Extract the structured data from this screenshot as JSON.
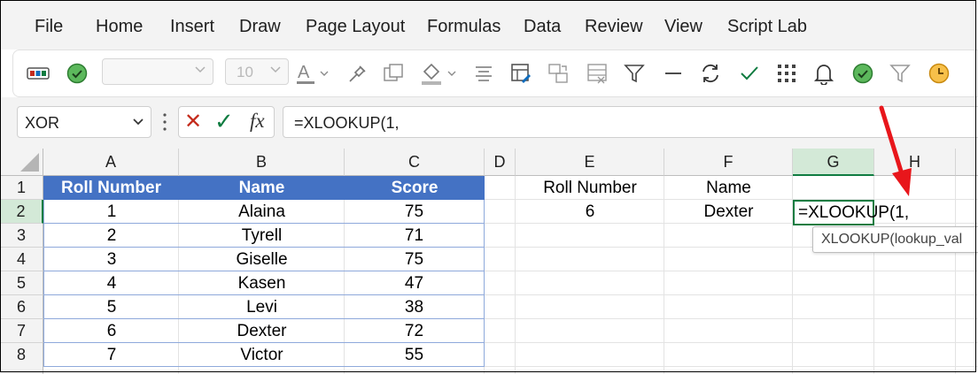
{
  "menu": [
    "File",
    "Home",
    "Insert",
    "Draw",
    "Page Layout",
    "Formulas",
    "Data",
    "Review",
    "View",
    "Script Lab"
  ],
  "ribbon": {
    "font_family_value": "",
    "font_size_value": "10",
    "icons": [
      "cell-styles-icon",
      "accessibility-check-icon",
      "font-color-icon",
      "format-painter-icon",
      "clear-icon",
      "fill-color-icon",
      "align-icon",
      "format-icon",
      "move-icon",
      "delete-icon",
      "filter-icon",
      "minus-icon",
      "refresh-icon",
      "checkmark-icon",
      "apps-grid-icon",
      "bell-icon",
      "approve-icon",
      "filter-outline-icon",
      "clock-icon"
    ]
  },
  "formula_bar": {
    "name_box": "XOR",
    "cancel_symbol": "✕",
    "enter_symbol": "✓",
    "fx_label": "fx",
    "formula": "=XLOOKUP(1,"
  },
  "columns": [
    "A",
    "B",
    "C",
    "D",
    "E",
    "F",
    "G",
    "H"
  ],
  "rows": [
    "1",
    "2",
    "3",
    "4",
    "5",
    "6",
    "7",
    "8"
  ],
  "table": {
    "headers": [
      "Roll Number",
      "Name",
      "Score"
    ],
    "rows": [
      [
        "1",
        "Alaina",
        "75"
      ],
      [
        "2",
        "Tyrell",
        "71"
      ],
      [
        "3",
        "Giselle",
        "75"
      ],
      [
        "4",
        "Kasen",
        "47"
      ],
      [
        "5",
        "Levi",
        "38"
      ],
      [
        "6",
        "Dexter",
        "72"
      ],
      [
        "7",
        "Victor",
        "55"
      ]
    ]
  },
  "lookup": {
    "label_roll": "Roll Number",
    "label_name": "Name",
    "value_roll": "6",
    "value_name": "Dexter",
    "active_cell_text": "=XLOOKUP(1,"
  },
  "tooltip": "XLOOKUP(lookup_val",
  "colors": {
    "table_header": "#4472c4",
    "accent_green": "#107c41",
    "arrow": "#e8161b"
  }
}
